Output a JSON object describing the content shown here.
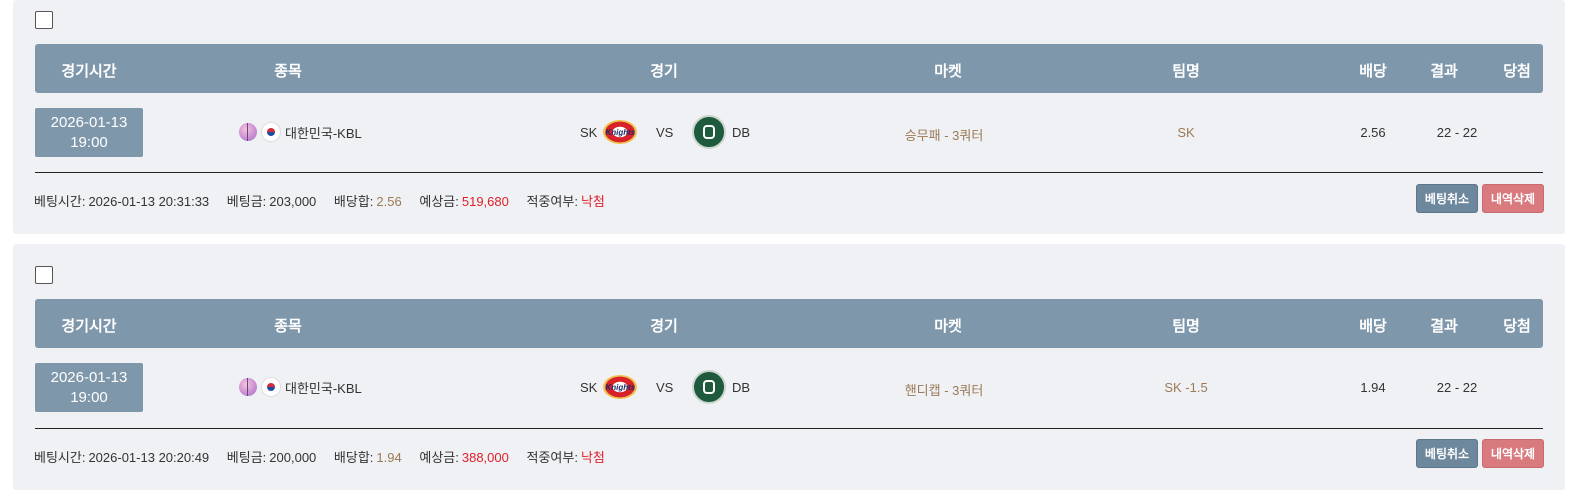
{
  "header": {
    "col_time": "경기시간",
    "col_sport": "종목",
    "col_game": "경기",
    "col_market": "마켓",
    "col_team": "팀명",
    "col_odds": "배당",
    "col_result": "결과",
    "col_win": "당첨"
  },
  "labels": {
    "vs": "VS",
    "bet_time": "베팅시간:",
    "bet_amount": "베팅금:",
    "odds_sum": "배당합:",
    "expected": "예상금:",
    "hit": "적중여부:",
    "cancel_button": "베팅취소",
    "delete_button": "내역삭제"
  },
  "bets": [
    {
      "date": "2026-01-13",
      "time": "19:00",
      "league": "대한민국-KBL",
      "home": "SK",
      "away": "DB",
      "market": "승무패 - 3쿼터",
      "team": "SK",
      "odds": "2.56",
      "result": "22 - 22",
      "bet_time": "2026-01-13 20:31:33",
      "bet_amount": "203,000",
      "odds_sum": "2.56",
      "expected": "519,680",
      "hit_status": "낙첨"
    },
    {
      "date": "2026-01-13",
      "time": "19:00",
      "league": "대한민국-KBL",
      "home": "SK",
      "away": "DB",
      "market": "핸디캡 - 3쿼터",
      "team": "SK -1.5",
      "odds": "1.94",
      "result": "22 - 22",
      "bet_time": "2026-01-13 20:20:49",
      "bet_amount": "200,000",
      "odds_sum": "1.94",
      "expected": "388,000",
      "hit_status": "낙첨"
    }
  ],
  "icons": {
    "sport": "basketball-icon",
    "flag": "korea-flag-icon",
    "home_logo": "sk-knights-logo-icon",
    "away_logo": "db-promy-logo-icon"
  },
  "colors": {
    "header_bg": "#7f97ab",
    "card_bg": "#f0f1f4",
    "accent_brown": "#9b7a55",
    "accent_red": "#e0202a",
    "cancel_btn": "#6d879c",
    "delete_btn": "#d97a7e"
  }
}
